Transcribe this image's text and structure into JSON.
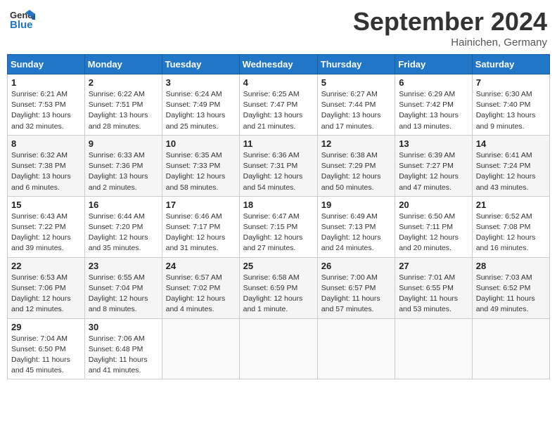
{
  "header": {
    "logo_line1": "General",
    "logo_line2": "Blue",
    "month_title": "September 2024",
    "location": "Hainichen, Germany"
  },
  "weekdays": [
    "Sunday",
    "Monday",
    "Tuesday",
    "Wednesday",
    "Thursday",
    "Friday",
    "Saturday"
  ],
  "weeks": [
    [
      {
        "day": "1",
        "lines": [
          "Sunrise: 6:21 AM",
          "Sunset: 7:53 PM",
          "Daylight: 13 hours",
          "and 32 minutes."
        ]
      },
      {
        "day": "2",
        "lines": [
          "Sunrise: 6:22 AM",
          "Sunset: 7:51 PM",
          "Daylight: 13 hours",
          "and 28 minutes."
        ]
      },
      {
        "day": "3",
        "lines": [
          "Sunrise: 6:24 AM",
          "Sunset: 7:49 PM",
          "Daylight: 13 hours",
          "and 25 minutes."
        ]
      },
      {
        "day": "4",
        "lines": [
          "Sunrise: 6:25 AM",
          "Sunset: 7:47 PM",
          "Daylight: 13 hours",
          "and 21 minutes."
        ]
      },
      {
        "day": "5",
        "lines": [
          "Sunrise: 6:27 AM",
          "Sunset: 7:44 PM",
          "Daylight: 13 hours",
          "and 17 minutes."
        ]
      },
      {
        "day": "6",
        "lines": [
          "Sunrise: 6:29 AM",
          "Sunset: 7:42 PM",
          "Daylight: 13 hours",
          "and 13 minutes."
        ]
      },
      {
        "day": "7",
        "lines": [
          "Sunrise: 6:30 AM",
          "Sunset: 7:40 PM",
          "Daylight: 13 hours",
          "and 9 minutes."
        ]
      }
    ],
    [
      {
        "day": "8",
        "lines": [
          "Sunrise: 6:32 AM",
          "Sunset: 7:38 PM",
          "Daylight: 13 hours",
          "and 6 minutes."
        ]
      },
      {
        "day": "9",
        "lines": [
          "Sunrise: 6:33 AM",
          "Sunset: 7:36 PM",
          "Daylight: 13 hours",
          "and 2 minutes."
        ]
      },
      {
        "day": "10",
        "lines": [
          "Sunrise: 6:35 AM",
          "Sunset: 7:33 PM",
          "Daylight: 12 hours",
          "and 58 minutes."
        ]
      },
      {
        "day": "11",
        "lines": [
          "Sunrise: 6:36 AM",
          "Sunset: 7:31 PM",
          "Daylight: 12 hours",
          "and 54 minutes."
        ]
      },
      {
        "day": "12",
        "lines": [
          "Sunrise: 6:38 AM",
          "Sunset: 7:29 PM",
          "Daylight: 12 hours",
          "and 50 minutes."
        ]
      },
      {
        "day": "13",
        "lines": [
          "Sunrise: 6:39 AM",
          "Sunset: 7:27 PM",
          "Daylight: 12 hours",
          "and 47 minutes."
        ]
      },
      {
        "day": "14",
        "lines": [
          "Sunrise: 6:41 AM",
          "Sunset: 7:24 PM",
          "Daylight: 12 hours",
          "and 43 minutes."
        ]
      }
    ],
    [
      {
        "day": "15",
        "lines": [
          "Sunrise: 6:43 AM",
          "Sunset: 7:22 PM",
          "Daylight: 12 hours",
          "and 39 minutes."
        ]
      },
      {
        "day": "16",
        "lines": [
          "Sunrise: 6:44 AM",
          "Sunset: 7:20 PM",
          "Daylight: 12 hours",
          "and 35 minutes."
        ]
      },
      {
        "day": "17",
        "lines": [
          "Sunrise: 6:46 AM",
          "Sunset: 7:17 PM",
          "Daylight: 12 hours",
          "and 31 minutes."
        ]
      },
      {
        "day": "18",
        "lines": [
          "Sunrise: 6:47 AM",
          "Sunset: 7:15 PM",
          "Daylight: 12 hours",
          "and 27 minutes."
        ]
      },
      {
        "day": "19",
        "lines": [
          "Sunrise: 6:49 AM",
          "Sunset: 7:13 PM",
          "Daylight: 12 hours",
          "and 24 minutes."
        ]
      },
      {
        "day": "20",
        "lines": [
          "Sunrise: 6:50 AM",
          "Sunset: 7:11 PM",
          "Daylight: 12 hours",
          "and 20 minutes."
        ]
      },
      {
        "day": "21",
        "lines": [
          "Sunrise: 6:52 AM",
          "Sunset: 7:08 PM",
          "Daylight: 12 hours",
          "and 16 minutes."
        ]
      }
    ],
    [
      {
        "day": "22",
        "lines": [
          "Sunrise: 6:53 AM",
          "Sunset: 7:06 PM",
          "Daylight: 12 hours",
          "and 12 minutes."
        ]
      },
      {
        "day": "23",
        "lines": [
          "Sunrise: 6:55 AM",
          "Sunset: 7:04 PM",
          "Daylight: 12 hours",
          "and 8 minutes."
        ]
      },
      {
        "day": "24",
        "lines": [
          "Sunrise: 6:57 AM",
          "Sunset: 7:02 PM",
          "Daylight: 12 hours",
          "and 4 minutes."
        ]
      },
      {
        "day": "25",
        "lines": [
          "Sunrise: 6:58 AM",
          "Sunset: 6:59 PM",
          "Daylight: 12 hours",
          "and 1 minute."
        ]
      },
      {
        "day": "26",
        "lines": [
          "Sunrise: 7:00 AM",
          "Sunset: 6:57 PM",
          "Daylight: 11 hours",
          "and 57 minutes."
        ]
      },
      {
        "day": "27",
        "lines": [
          "Sunrise: 7:01 AM",
          "Sunset: 6:55 PM",
          "Daylight: 11 hours",
          "and 53 minutes."
        ]
      },
      {
        "day": "28",
        "lines": [
          "Sunrise: 7:03 AM",
          "Sunset: 6:52 PM",
          "Daylight: 11 hours",
          "and 49 minutes."
        ]
      }
    ],
    [
      {
        "day": "29",
        "lines": [
          "Sunrise: 7:04 AM",
          "Sunset: 6:50 PM",
          "Daylight: 11 hours",
          "and 45 minutes."
        ]
      },
      {
        "day": "30",
        "lines": [
          "Sunrise: 7:06 AM",
          "Sunset: 6:48 PM",
          "Daylight: 11 hours",
          "and 41 minutes."
        ]
      },
      {
        "day": "",
        "lines": []
      },
      {
        "day": "",
        "lines": []
      },
      {
        "day": "",
        "lines": []
      },
      {
        "day": "",
        "lines": []
      },
      {
        "day": "",
        "lines": []
      }
    ]
  ]
}
